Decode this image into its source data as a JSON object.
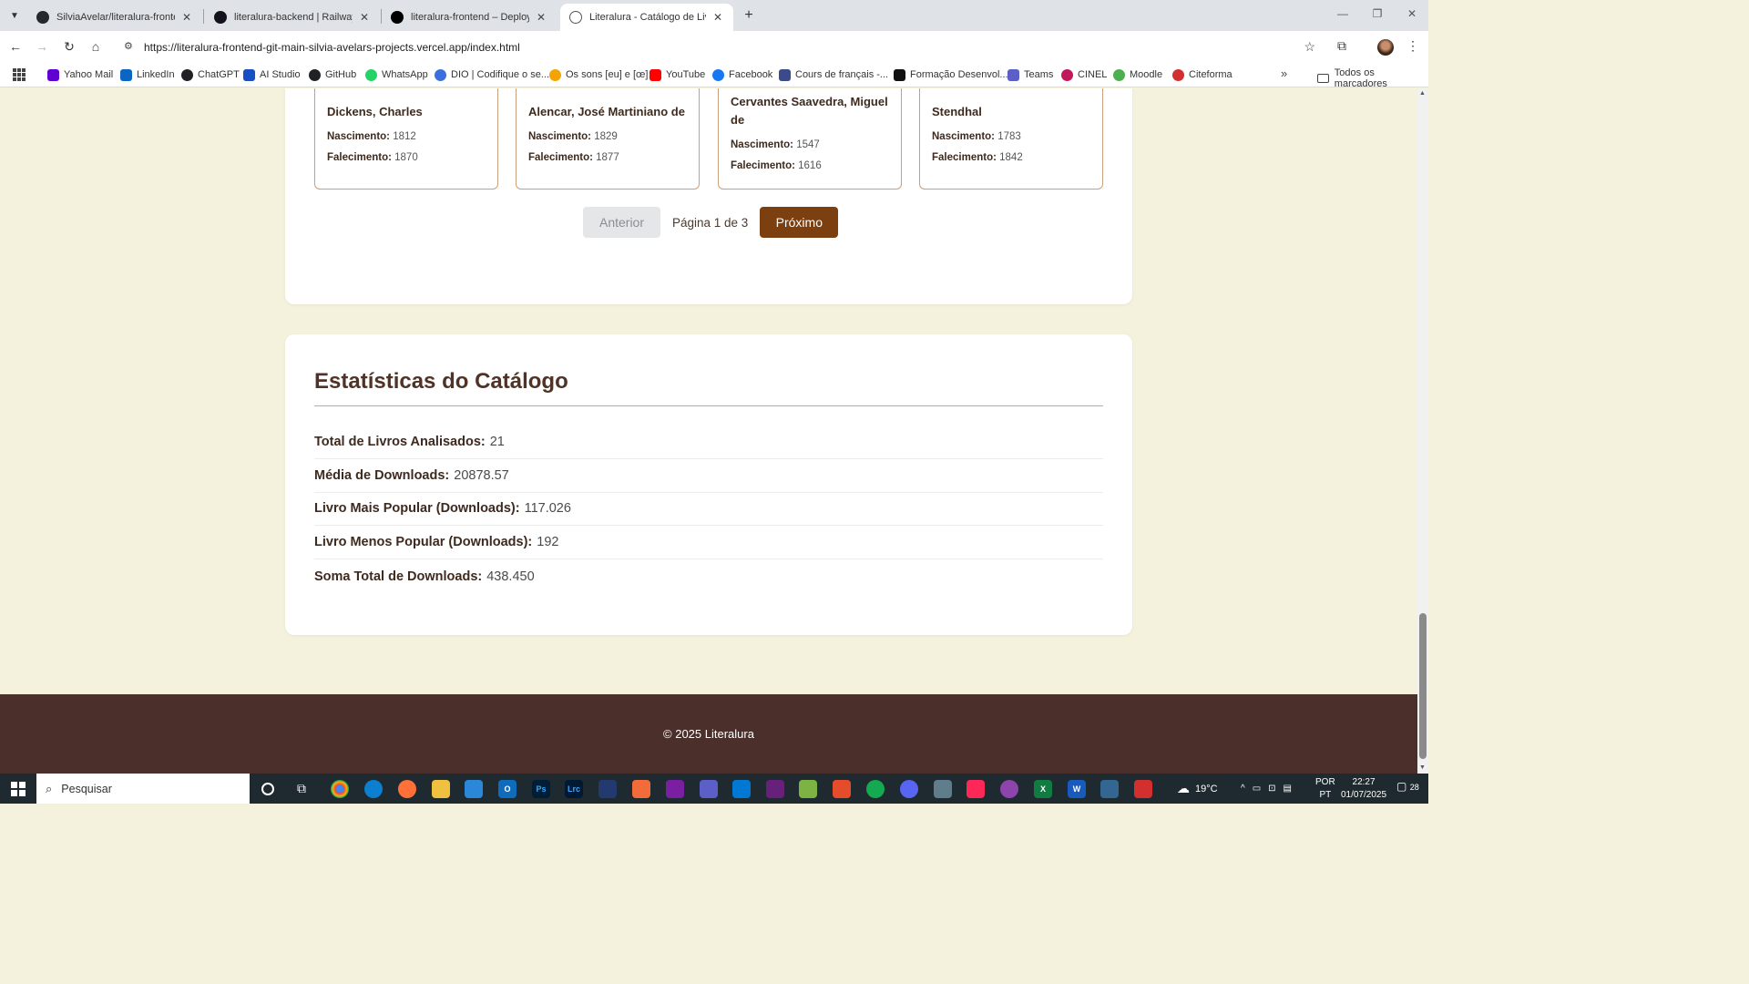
{
  "browser": {
    "tabs": [
      {
        "title": "SilviaAvelar/literalura-frontend",
        "active": false
      },
      {
        "title": "literalura-backend | Railway",
        "active": false
      },
      {
        "title": "literalura-frontend – Deployment",
        "active": false
      },
      {
        "title": "Literalura - Catálogo de Livros",
        "active": true
      }
    ],
    "new_tab": "+",
    "url": "https://literalura-frontend-git-main-silvia-avelars-projects.vercel.app/index.html",
    "bookmarks": [
      {
        "label": "Yahoo Mail",
        "color": "#6001d2"
      },
      {
        "label": "LinkedIn",
        "color": "#0a66c2"
      },
      {
        "label": "ChatGPT",
        "color": "#202124"
      },
      {
        "label": "AI Studio",
        "color": "#1a4fc4"
      },
      {
        "label": "GitHub",
        "color": "#202124"
      },
      {
        "label": "WhatsApp",
        "color": "#25d366"
      },
      {
        "label": "DIO | Codifique o se...",
        "color": "#3b6fe0"
      },
      {
        "label": "Os sons [eu] e [œ]",
        "color": "#f5a300"
      },
      {
        "label": "YouTube",
        "color": "#ff0000"
      },
      {
        "label": "Facebook",
        "color": "#1877f2"
      },
      {
        "label": "Cours de français -...",
        "color": "#3b4a8a"
      },
      {
        "label": "Formação Desenvol...",
        "color": "#111111"
      },
      {
        "label": "Teams",
        "color": "#5b5fc7"
      },
      {
        "label": "CINEL",
        "color": "#c2185b"
      },
      {
        "label": "Moodle",
        "color": "#4caf50"
      },
      {
        "label": "Citeforma",
        "color": "#d32f2f"
      }
    ],
    "bookmarks_more": "»",
    "all_bookmarks": "Todos os marcadores"
  },
  "authors": [
    {
      "name": "Dickens, Charles",
      "birth_label": "Nascimento:",
      "birth": "1812",
      "death_label": "Falecimento:",
      "death": "1870"
    },
    {
      "name": "Alencar, José Martiniano de",
      "birth_label": "Nascimento:",
      "birth": "1829",
      "death_label": "Falecimento:",
      "death": "1877"
    },
    {
      "name": "Cervantes Saavedra, Miguel de",
      "birth_label": "Nascimento:",
      "birth": "1547",
      "death_label": "Falecimento:",
      "death": "1616"
    },
    {
      "name": "Stendhal",
      "birth_label": "Nascimento:",
      "birth": "1783",
      "death_label": "Falecimento:",
      "death": "1842"
    }
  ],
  "pagination": {
    "prev_label": "Anterior",
    "info": "Página 1 de 3",
    "next_label": "Próximo"
  },
  "stats": {
    "title": "Estatísticas do Catálogo",
    "rows": [
      {
        "label": "Total de Livros Analisados:",
        "value": "21"
      },
      {
        "label": "Média de Downloads:",
        "value": "20878.57"
      },
      {
        "label": "Livro Mais Popular (Downloads):",
        "value": "117.026"
      },
      {
        "label": "Livro Menos Popular (Downloads):",
        "value": "192"
      },
      {
        "label": "Soma Total de Downloads:",
        "value": "438.450"
      }
    ]
  },
  "footer": {
    "text": "© 2025 Literalura"
  },
  "taskbar": {
    "search_placeholder": "Pesquisar",
    "weather": "19°C",
    "lang_line1": "POR",
    "lang_line2": "PT",
    "time": "22:27",
    "date": "01/07/2025",
    "notification_count": "28"
  },
  "colors": {
    "page_bg": "#f4f2dc",
    "accent_brown": "#7b3f10",
    "footer_bg": "#4a2f2b",
    "card_border": "#c8a07e"
  }
}
